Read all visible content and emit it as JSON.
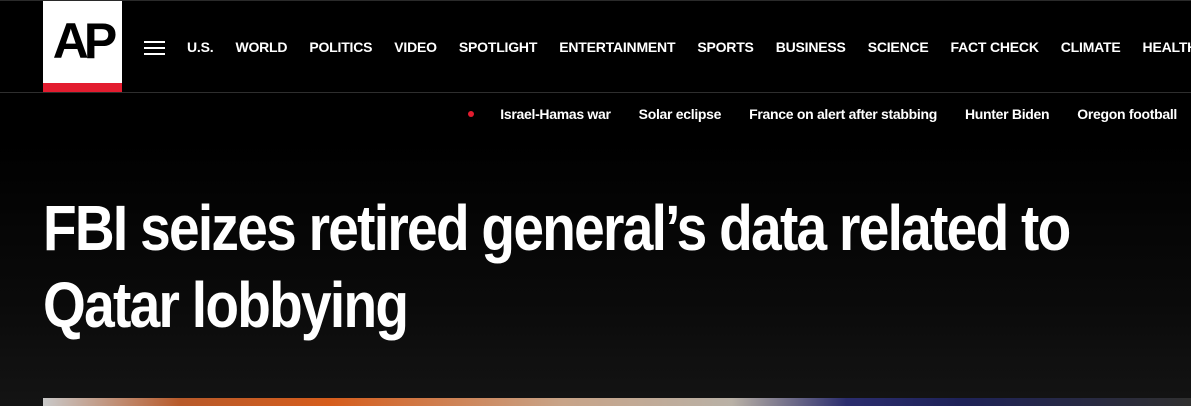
{
  "brand": {
    "logo_text": "AP"
  },
  "nav": {
    "menu_icon": "hamburger-menu-icon",
    "items": [
      "U.S.",
      "WORLD",
      "POLITICS",
      "VIDEO",
      "SPOTLIGHT",
      "ENTERTAINMENT",
      "SPORTS",
      "BUSINESS",
      "SCIENCE",
      "FACT CHECK",
      "CLIMATE",
      "HEALTH"
    ]
  },
  "trending": {
    "live_indicator_color": "#e31c2f",
    "items": [
      "Israel-Hamas war",
      "Solar eclipse",
      "France on alert after stabbing",
      "Hunter Biden",
      "Oregon football"
    ]
  },
  "article": {
    "headline": "FBI seizes retired general’s data related to Qatar lobbying"
  },
  "colors": {
    "accent_red": "#e31c2f",
    "background": "#000000",
    "text": "#ffffff"
  }
}
